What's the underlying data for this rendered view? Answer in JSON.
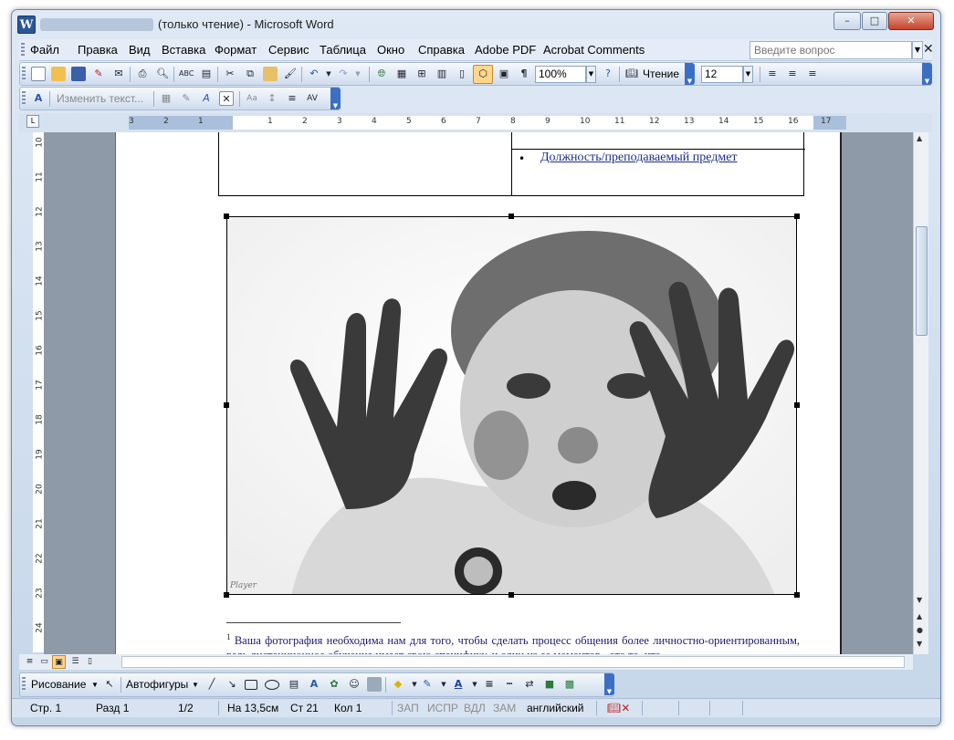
{
  "window": {
    "title": "(только чтение) - Microsoft Word",
    "icon_letter": "W",
    "controls": [
      "–",
      "□",
      "✕"
    ]
  },
  "menu": {
    "items": [
      "Файл",
      "Правка",
      "Вид",
      "Вставка",
      "Формат",
      "Сервис",
      "Таблица",
      "Окно",
      "Справка",
      "Adobe PDF",
      "Acrobat Comments"
    ],
    "ask_placeholder": "Введите вопрос",
    "close_glyph": "✕"
  },
  "toolbar": {
    "zoom": "100%",
    "reading_label": "Чтение",
    "font_size": "12",
    "change_text_label": "Изменить текст..."
  },
  "ruler": {
    "h_numbers": [
      "3",
      "2",
      "1",
      "1",
      "2",
      "3",
      "4",
      "5",
      "6",
      "7",
      "8",
      "9",
      "10",
      "11",
      "12",
      "13",
      "14",
      "15",
      "16",
      "17"
    ],
    "v_numbers": [
      "10",
      "11",
      "12",
      "13",
      "14",
      "15",
      "16",
      "17",
      "18",
      "19",
      "20",
      "21",
      "22",
      "23",
      "24"
    ]
  },
  "document": {
    "table_cell_text": "Должность/преподаваемый предмет",
    "bullet": "•",
    "footnote_number": "1",
    "footnote_text": "Ваша фотография необходима нам для того, чтобы сделать процесс общения более личностно-ориентированным, ведь дистанционное обучение имеет свою специфику, и один из ее моментов - это то, что",
    "photo_signature": "Player"
  },
  "drawing": {
    "draw_label": "Рисование",
    "autoshapes_label": "Автофигуры"
  },
  "status": {
    "page": "Стр. 1",
    "section": "Разд 1",
    "pages": "1/2",
    "position": "На 13,5см",
    "line": "Ст 21",
    "column": "Кол 1",
    "rec": "ЗАП",
    "trk": "ИСПР",
    "ext": "ВДЛ",
    "ovr": "ЗАМ",
    "language": "английский"
  },
  "colors": {
    "accent": "#2b5797",
    "toolbar_chevron": "#3a6fc4",
    "active_button": "#ffd68a",
    "link_text": "#1f2d8a"
  }
}
